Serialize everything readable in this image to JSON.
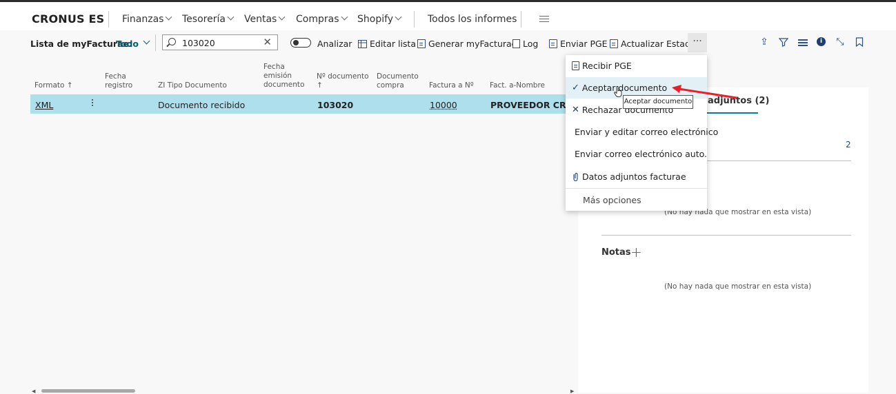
{
  "app": {
    "brand": "CRONUS ES"
  },
  "nav": {
    "items": [
      {
        "label": "Finanzas",
        "chevron": true
      },
      {
        "label": "Tesorería",
        "chevron": true
      },
      {
        "label": "Ventas",
        "chevron": true
      },
      {
        "label": "Compras",
        "chevron": true
      },
      {
        "label": "Shopify",
        "chevron": true
      },
      {
        "label": "Todos los informes",
        "chevron": false
      }
    ],
    "menu_icon": "hamburger-icon"
  },
  "toolbar": {
    "list_title": "Lista de myFacturae:",
    "filter_view": "Todo",
    "search": {
      "value": "103020",
      "icon": "search-icon",
      "clear_icon": "close-icon"
    },
    "analyze_label": "Analizar",
    "edit_list_label": "Editar lista",
    "generate_label": "Generar myFacturae",
    "log_label": "Log",
    "send_pge_label": "Enviar PGE",
    "update_status_label": "Actualizar Estado",
    "more_label": "···"
  },
  "table": {
    "columns": [
      {
        "label": "Formato ↑"
      },
      {
        "label": "Fecha\nregistro"
      },
      {
        "label": "ZI Tipo Documento"
      },
      {
        "label": "Fecha\nemisión\ndocumento"
      },
      {
        "label": "Nº documento\n↑"
      },
      {
        "label": "Documento\ncompra"
      },
      {
        "label": "Factura a Nº"
      },
      {
        "label": "Fact. a-Nombre"
      }
    ],
    "rows": [
      {
        "formato": "XML",
        "fecha_registro": "",
        "tipo_documento": "Documento recibido",
        "fecha_emision": "",
        "n_documento": "103020",
        "documento_compra": "",
        "factura_a": "10000",
        "nombre": "PROVEEDOR CRONU"
      }
    ]
  },
  "menu": {
    "items": [
      {
        "label": "Recibir PGE",
        "icon": "document-icon"
      },
      {
        "label": "Aceptar documento",
        "icon": "check-icon"
      },
      {
        "label": "Rechazar documento",
        "icon": "x-icon"
      },
      {
        "label": "Enviar y editar correo electrónico",
        "icon": "mail-icon"
      },
      {
        "label": "Enviar correo electrónico auto.",
        "icon": "mail-icon"
      },
      {
        "label": "Datos adjuntos facturae",
        "icon": "paperclip-icon"
      },
      {
        "label": "Más opciones",
        "icon": ""
      }
    ],
    "tooltip": "Aceptar documento"
  },
  "factbox": {
    "attachments_tab": "adjuntos (2)",
    "count": "2",
    "empty_text_1": "(No hay nada que mostrar en esta vista)",
    "notes_label": "Notas",
    "empty_text_2": "(No hay nada que mostrar en esta vista)"
  },
  "colors": {
    "selected_row": "#ade0ec",
    "accent": "#00809a",
    "annotation_arrow": "#e8202a"
  }
}
